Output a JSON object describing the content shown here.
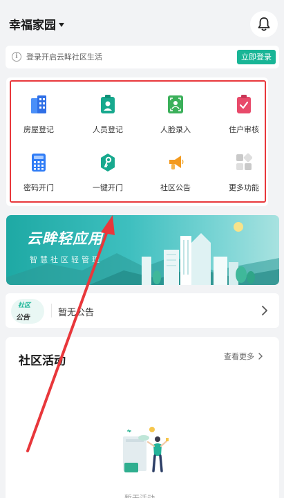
{
  "header": {
    "community_name": "幸福家园",
    "bell_icon": "bell-icon"
  },
  "login_bar": {
    "text": "登录开启云眸社区生活",
    "button": "立即登录"
  },
  "functions": [
    {
      "label": "房屋登记",
      "icon": "building-icon",
      "color": "#2f7cf6"
    },
    {
      "label": "人员登记",
      "icon": "id-badge-icon",
      "color": "#17a98e"
    },
    {
      "label": "人脸录入",
      "icon": "face-scan-icon",
      "color": "#3bb05a"
    },
    {
      "label": "住户审核",
      "icon": "clipboard-check-icon",
      "color": "#e84a6a"
    },
    {
      "label": "密码开门",
      "icon": "keypad-icon",
      "color": "#2f7cf6"
    },
    {
      "label": "一键开门",
      "icon": "key-icon",
      "color": "#17a98e"
    },
    {
      "label": "社区公告",
      "icon": "megaphone-icon",
      "color": "#f39a1e"
    },
    {
      "label": "更多功能",
      "icon": "grid-more-icon",
      "color": "#c9c9c9"
    }
  ],
  "banner": {
    "title": "云眸轻应用",
    "subtitle": "智慧社区轻管理"
  },
  "notice": {
    "badge_top": "社区",
    "badge_bottom": "公告",
    "text": "暂无公告"
  },
  "activity": {
    "title": "社区活动",
    "more": "查看更多",
    "empty": "暂无活动"
  },
  "colors": {
    "accent": "#19b596",
    "annotation_red": "#e8373b"
  }
}
